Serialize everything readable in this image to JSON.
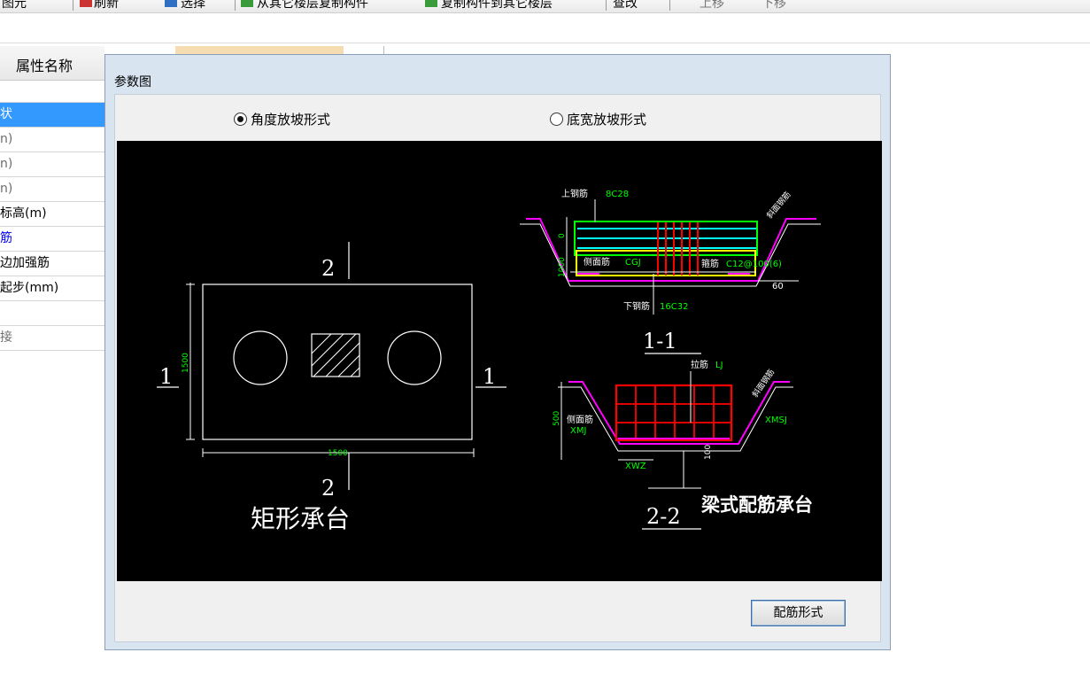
{
  "toolbar": {
    "items": [
      "图元",
      "刷新",
      "选择",
      "从其它楼层复制构件",
      "复制构件到其它楼层",
      "查改",
      "上移",
      "下移"
    ]
  },
  "property_panel": {
    "header": "属性名称",
    "rows": [
      "",
      "状",
      "n)",
      "n)",
      "n)",
      "标高(m)",
      "筋",
      "边加强筋",
      "起步(mm)",
      "",
      "接"
    ]
  },
  "dialog": {
    "title": "参数图",
    "radio_angle": "角度放坡形式",
    "radio_width": "底宽放坡形式",
    "button": "配筋形式"
  },
  "drawing": {
    "plan_title": "矩形承台",
    "plan_dim_w": "1500",
    "plan_dim_h": "1500",
    "section_mark_2": "2",
    "section_mark_1": "1",
    "section_1_1": "1-1",
    "section_2_2": "2-2",
    "section_title": "梁式配筋承台",
    "label_top_bar": "上钢筋",
    "label_top_bar_spec": "8C28",
    "label_side_bar": "侧面筋",
    "label_side_bar_spec": "CGJ",
    "label_stirrup": "箍筋",
    "label_stirrup_spec": "C12@100(6)",
    "label_bottom_bar": "下钢筋",
    "label_bottom_bar_spec": "16C32",
    "label_tie": "拉筋",
    "label_tie_spec": "LJ",
    "label_side_bar2": "侧面筋",
    "label_xmj": "XMJ",
    "label_xmsj": "XMSJ",
    "label_xwz": "XWZ",
    "label_slope_rebar": "斜面钢筋",
    "label_h": "1000",
    "label_500": "500",
    "label_100": "100",
    "label_0": "0",
    "label_60": "60"
  },
  "colors": {
    "selected_row": "#3399ff",
    "canvas": "#000000",
    "green": "#00ff00",
    "red": "#ff0000",
    "magenta": "#ff00ff",
    "cyan": "#00ffff",
    "yellow": "#ffff00"
  }
}
